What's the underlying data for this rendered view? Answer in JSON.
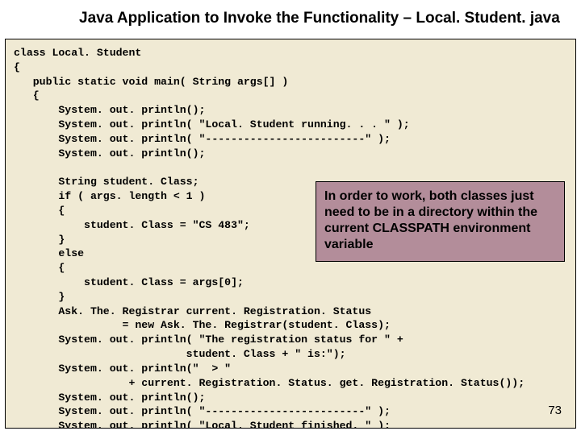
{
  "title": "Java Application to Invoke the Functionality – Local. Student. java",
  "code": "class Local. Student\n{\n   public static void main( String args[] )\n   {\n       System. out. println();\n       System. out. println( \"Local. Student running. . . \" );\n       System. out. println( \"-------------------------\" );\n       System. out. println();\n\n       String student. Class;\n       if ( args. length < 1 )\n       {\n           student. Class = \"CS 483\";\n       }\n       else\n       {\n           student. Class = args[0];\n       }\n       Ask. The. Registrar current. Registration. Status\n                 = new Ask. The. Registrar(student. Class);\n       System. out. println( \"The registration status for \" +\n                           student. Class + \" is:\");\n       System. out. println(\"  > \"\n                  + current. Registration. Status. get. Registration. Status());\n       System. out. println();\n       System. out. println( \"-------------------------\" );\n       System. out. println( \"Local. Student finished. \" );\n   }",
  "callout": "In order to work, both classes just need to be in a directory within the current CLASSPATH environment variable",
  "page_number": "73"
}
